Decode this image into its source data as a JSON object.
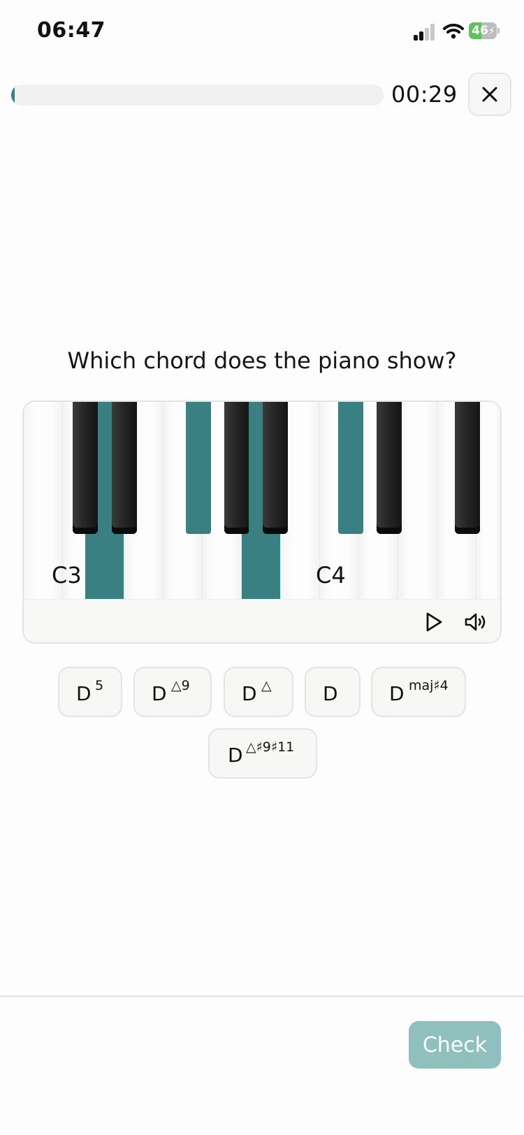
{
  "status_bar": {
    "time": "06:47",
    "battery_level": "46",
    "battery_fraction": 0.46
  },
  "progress": {
    "fraction": 0.01,
    "color": "#3a7f81"
  },
  "timer": "00:29",
  "close_icon": "close-icon",
  "question": "Which chord does the piano show?",
  "piano": {
    "labels": {
      "first": "C3",
      "second": "C4"
    },
    "highlight_color": "#3a7f81",
    "play_icon": "play-icon",
    "volume_icon": "speaker-icon"
  },
  "options": [
    {
      "root": "D",
      "ext": "5"
    },
    {
      "root": "D",
      "ext": "△9"
    },
    {
      "root": "D",
      "ext": "△"
    },
    {
      "root": "D",
      "ext": ""
    },
    {
      "root": "D",
      "ext": "maj♯4"
    },
    {
      "root": "D",
      "ext": "△♯9♯11"
    }
  ],
  "check_label": "Check",
  "check_color": "#8fc0be"
}
